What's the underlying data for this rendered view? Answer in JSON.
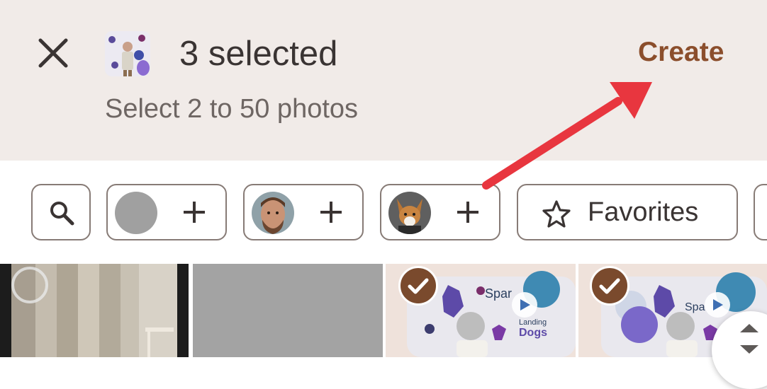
{
  "header": {
    "close_icon": "close-icon",
    "title": "3 selected",
    "create_label": "Create",
    "subtitle": "Select 2 to 50 photos"
  },
  "chips": {
    "search_icon": "search-icon",
    "people": [
      {
        "name": "gray-person-chip",
        "plus_icon": "plus-icon"
      },
      {
        "name": "man-chip",
        "plus_icon": "plus-icon"
      },
      {
        "name": "dog-chip",
        "plus_icon": "plus-icon"
      }
    ],
    "favorites_label": "Favorites",
    "star_icon": "star-icon"
  },
  "grid": {
    "tiles": [
      {
        "name": "photo-room",
        "selected": false
      },
      {
        "name": "photo-placeholder",
        "selected": false
      },
      {
        "name": "photo-kid-booth-1",
        "selected": true
      },
      {
        "name": "photo-kid-booth-2",
        "selected": true
      }
    ]
  },
  "colors": {
    "header_bg": "#f1ebe8",
    "accent": "#8b4e2c",
    "check_bg": "#7a4a2d",
    "arrow": "#e8363f"
  }
}
